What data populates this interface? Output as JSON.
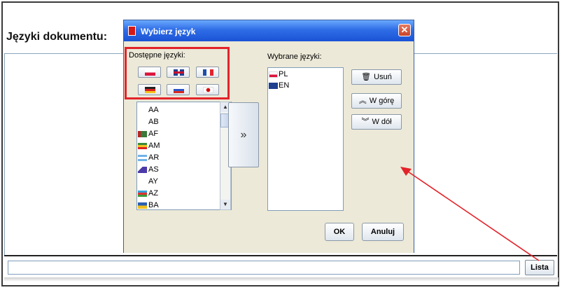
{
  "page": {
    "section_label": "Języki dokumentu:",
    "list_button": "Lista",
    "bottom_input_value": ""
  },
  "dialog": {
    "title": "Wybierz język",
    "close_glyph": "✕",
    "available_label": "Dostępne języki:",
    "selected_label": "Wybrane języki:",
    "quick_flags": [
      "pl-flag-icon",
      "gb-flag-icon",
      "fr-flag-icon",
      "de-flag-icon",
      "ru-flag-icon",
      "jp-flag-icon"
    ],
    "available_languages": [
      {
        "code": "AA",
        "flag": ""
      },
      {
        "code": "AB",
        "flag": ""
      },
      {
        "code": "AF",
        "flag": "af-flag-icon"
      },
      {
        "code": "AM",
        "flag": "am-flag-icon"
      },
      {
        "code": "AR",
        "flag": "ar-flag-icon"
      },
      {
        "code": "AS",
        "flag": "as-flag-icon"
      },
      {
        "code": "AY",
        "flag": ""
      },
      {
        "code": "AZ",
        "flag": "az-flag-icon"
      },
      {
        "code": "BA",
        "flag": "ba-flag-icon"
      }
    ],
    "move_button": "»",
    "selected_languages": [
      {
        "code": "PL",
        "flag": "pl-flag-icon"
      },
      {
        "code": "EN",
        "flag": "gb-flag-icon"
      }
    ],
    "remove_button": "Usuń",
    "up_button": "W górę",
    "down_button": "W dół",
    "ok_button": "OK",
    "cancel_button": "Anuluj"
  },
  "colors": {
    "highlight": "#e3232a",
    "annotation_arrow": "#e3232a",
    "titlebar": "#2f6de6"
  }
}
